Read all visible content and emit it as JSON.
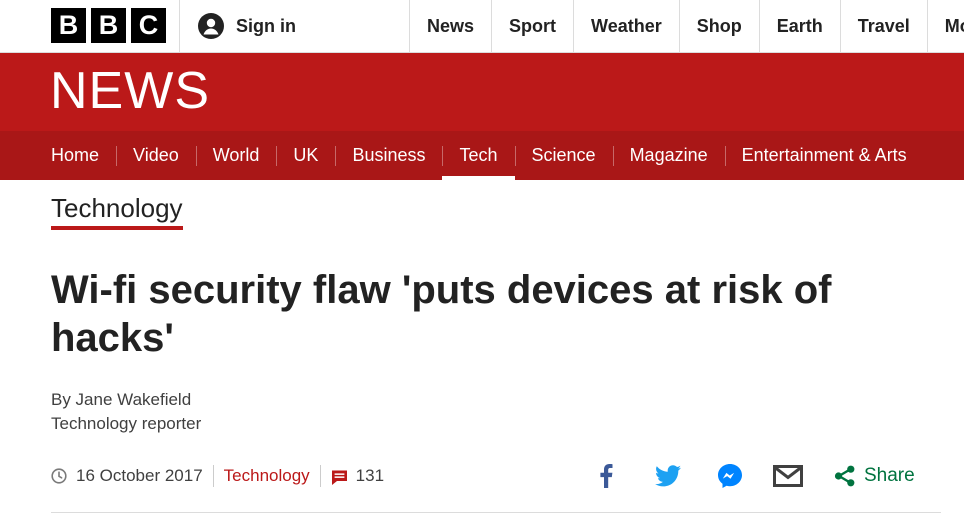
{
  "header": {
    "logo_letters": [
      "B",
      "B",
      "C"
    ],
    "signin_label": "Sign in",
    "topnav": [
      "News",
      "Sport",
      "Weather",
      "Shop",
      "Earth",
      "Travel",
      "Mo"
    ]
  },
  "banner": {
    "wordmark": "NEWS"
  },
  "section_nav": {
    "items": [
      "Home",
      "Video",
      "World",
      "UK",
      "Business",
      "Tech",
      "Science",
      "Magazine",
      "Entertainment & Arts"
    ],
    "active": "Tech"
  },
  "article": {
    "section_tag": "Technology",
    "headline": "Wi-fi security flaw 'puts devices at risk of hacks'",
    "byline_name": "By Jane Wakefield",
    "byline_role": "Technology reporter",
    "date": "16 October 2017",
    "tag": "Technology",
    "comment_count": "131"
  },
  "share": {
    "label": "Share",
    "icons": [
      "facebook-icon",
      "twitter-icon",
      "messenger-icon",
      "email-icon",
      "share-icon"
    ]
  },
  "colors": {
    "brand_red": "#bb1919",
    "nav_red": "#a91717",
    "facebook": "#3b5998",
    "twitter": "#1da1f2",
    "messenger": "#0084ff",
    "email": "#404040",
    "share_green": "#00733f"
  }
}
